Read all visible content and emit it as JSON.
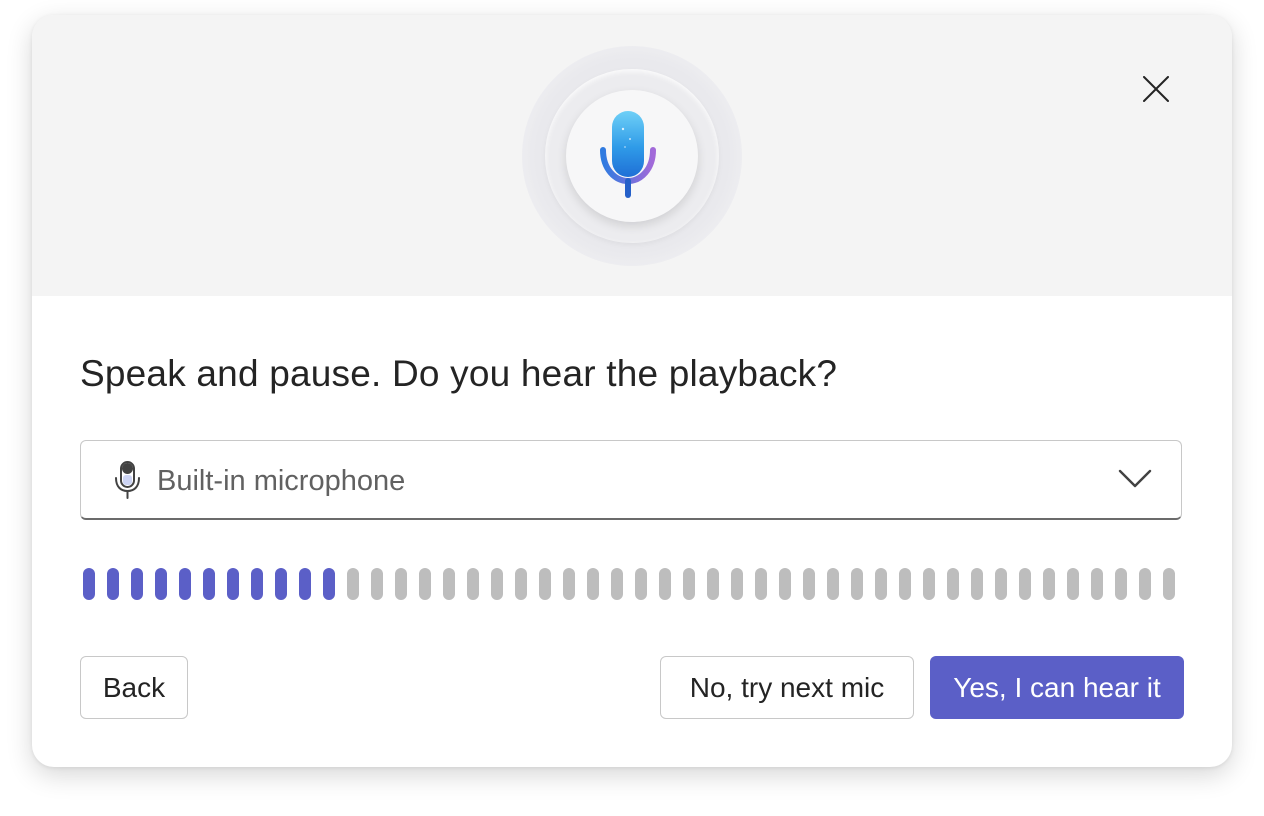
{
  "dialog": {
    "title": "Speak and pause. Do you hear the playback?",
    "close_icon": "close-icon",
    "hero_icon": "microphone-icon"
  },
  "device_select": {
    "icon": "microphone-icon",
    "value": "Built-in microphone",
    "chevron_icon": "chevron-down-icon"
  },
  "level_meter": {
    "total_segments": 46,
    "active_segments": 11,
    "active_color": "#5b5fc7",
    "inactive_color": "#bdbdbd"
  },
  "buttons": {
    "back": "Back",
    "try_next": "No, try next mic",
    "confirm": "Yes, I can hear it"
  },
  "colors": {
    "accent": "#5b5fc7",
    "hero_background": "#f4f4f4"
  }
}
